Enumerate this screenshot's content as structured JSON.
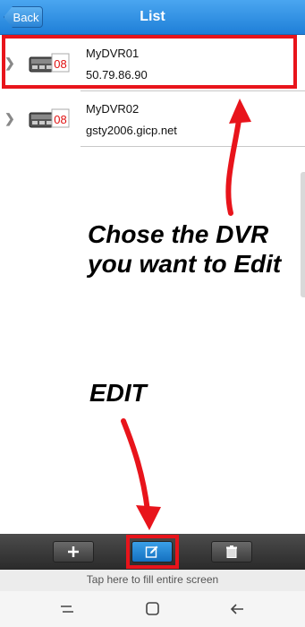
{
  "header": {
    "back_label": "Back",
    "title": "List"
  },
  "devices": [
    {
      "name": "MyDVR01",
      "address": "50.79.86.90",
      "badge": "08"
    },
    {
      "name": "MyDVR02",
      "address": "gsty2006.gicp.net",
      "badge": "08"
    }
  ],
  "annotations": {
    "choose_line1": "Chose the DVR",
    "choose_line2": "you want to Edit",
    "edit": "EDIT",
    "highlight_color": "#e8141b"
  },
  "toolbar": {
    "add_icon": "plus-icon",
    "edit_icon": "edit-icon",
    "delete_icon": "trash-icon"
  },
  "tap_bar": {
    "text": "Tap here to fill entire screen"
  },
  "system_nav": {
    "recent_icon": "recent-apps-icon",
    "home_icon": "home-icon",
    "back_icon": "back-arrow-icon"
  }
}
